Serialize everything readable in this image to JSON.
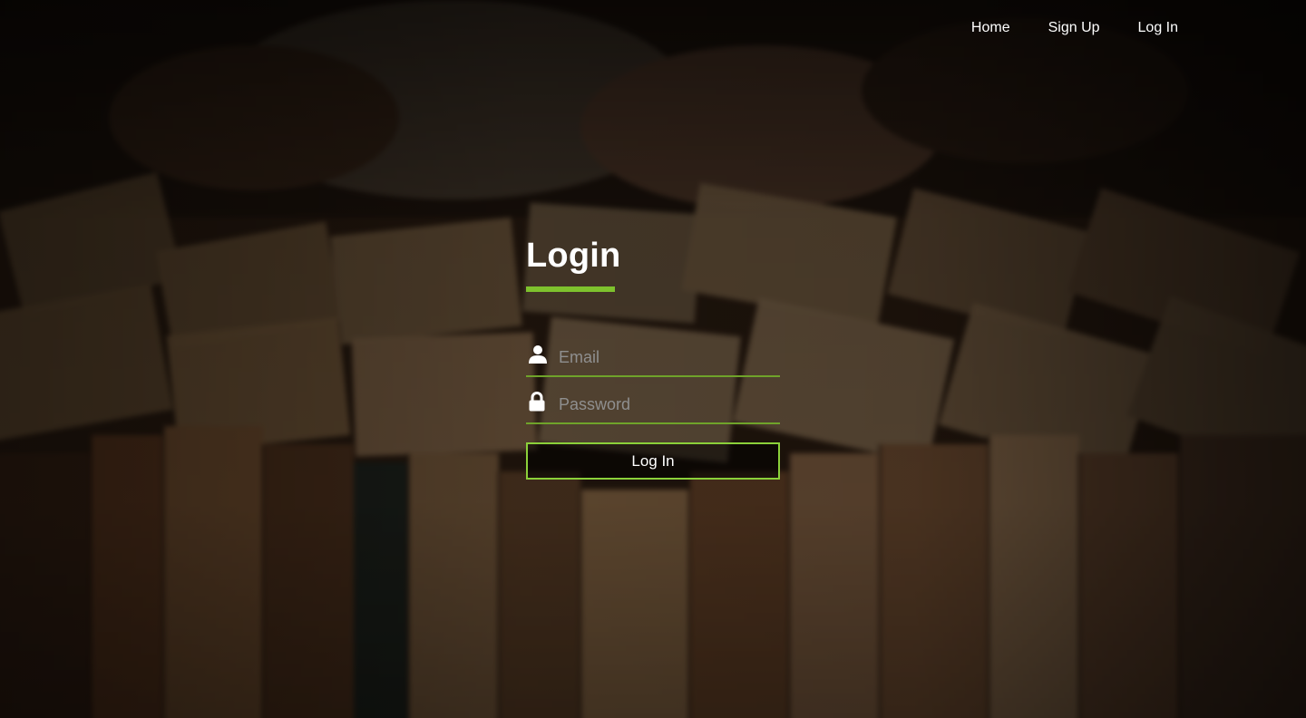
{
  "nav": {
    "items": [
      {
        "label": "Home"
      },
      {
        "label": "Sign Up"
      },
      {
        "label": "Log In"
      }
    ]
  },
  "login": {
    "title": "Login",
    "email_placeholder": "Email",
    "password_placeholder": "Password",
    "submit_label": "Log In"
  },
  "icons": {
    "email": "user-icon",
    "password": "lock-icon"
  },
  "colors": {
    "accent": "#7ec22d",
    "field_border": "#6fa32a",
    "button_border": "#8bd03a",
    "text": "#ffffff",
    "placeholder": "#8f8f8f"
  }
}
